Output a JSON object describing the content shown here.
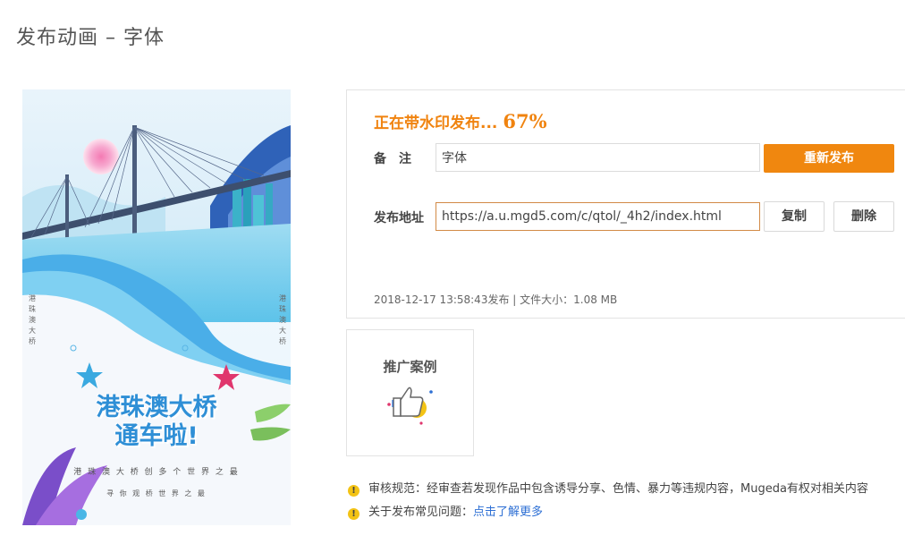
{
  "page": {
    "title": "发布动画 – 字体"
  },
  "poster": {
    "headline_line1": "港珠澳大桥",
    "headline_line2": "通车啦!",
    "caption1": "港 珠 澳 大 桥 创 多 个 世 界 之 最",
    "caption2": "寻 你 观 桥 世 界 之 最",
    "side_text": "港珠澳大桥"
  },
  "publish": {
    "status_text": "正在带水印发布...",
    "progress_percent": "67%",
    "progress_value": 67,
    "note_label": "备注",
    "note_value": "字体",
    "republish_button": "重新发布",
    "url_label": "发布地址",
    "url_value": "https://a.u.mgd5.com/c/qtol/_4h2/index.html",
    "copy_button": "复制",
    "delete_button": "删除",
    "meta_text": "2018-12-17 13:58:43发布 | 文件大小：1.08 MB"
  },
  "promo": {
    "label": "推广案例",
    "icon": "thumbs-up-icon"
  },
  "notices": {
    "rules_text": "审核规范：经审查若发现作品中包含诱导分享、色情、暴力等违规内容，Mugeda有权对相关内容",
    "faq_prefix": "关于发布常见问题：",
    "faq_link": "点击了解更多"
  },
  "colors": {
    "accent": "#f0870f",
    "link": "#2d6fd4",
    "warning": "#f3c315",
    "poster_headline": "#2f8fd6"
  }
}
